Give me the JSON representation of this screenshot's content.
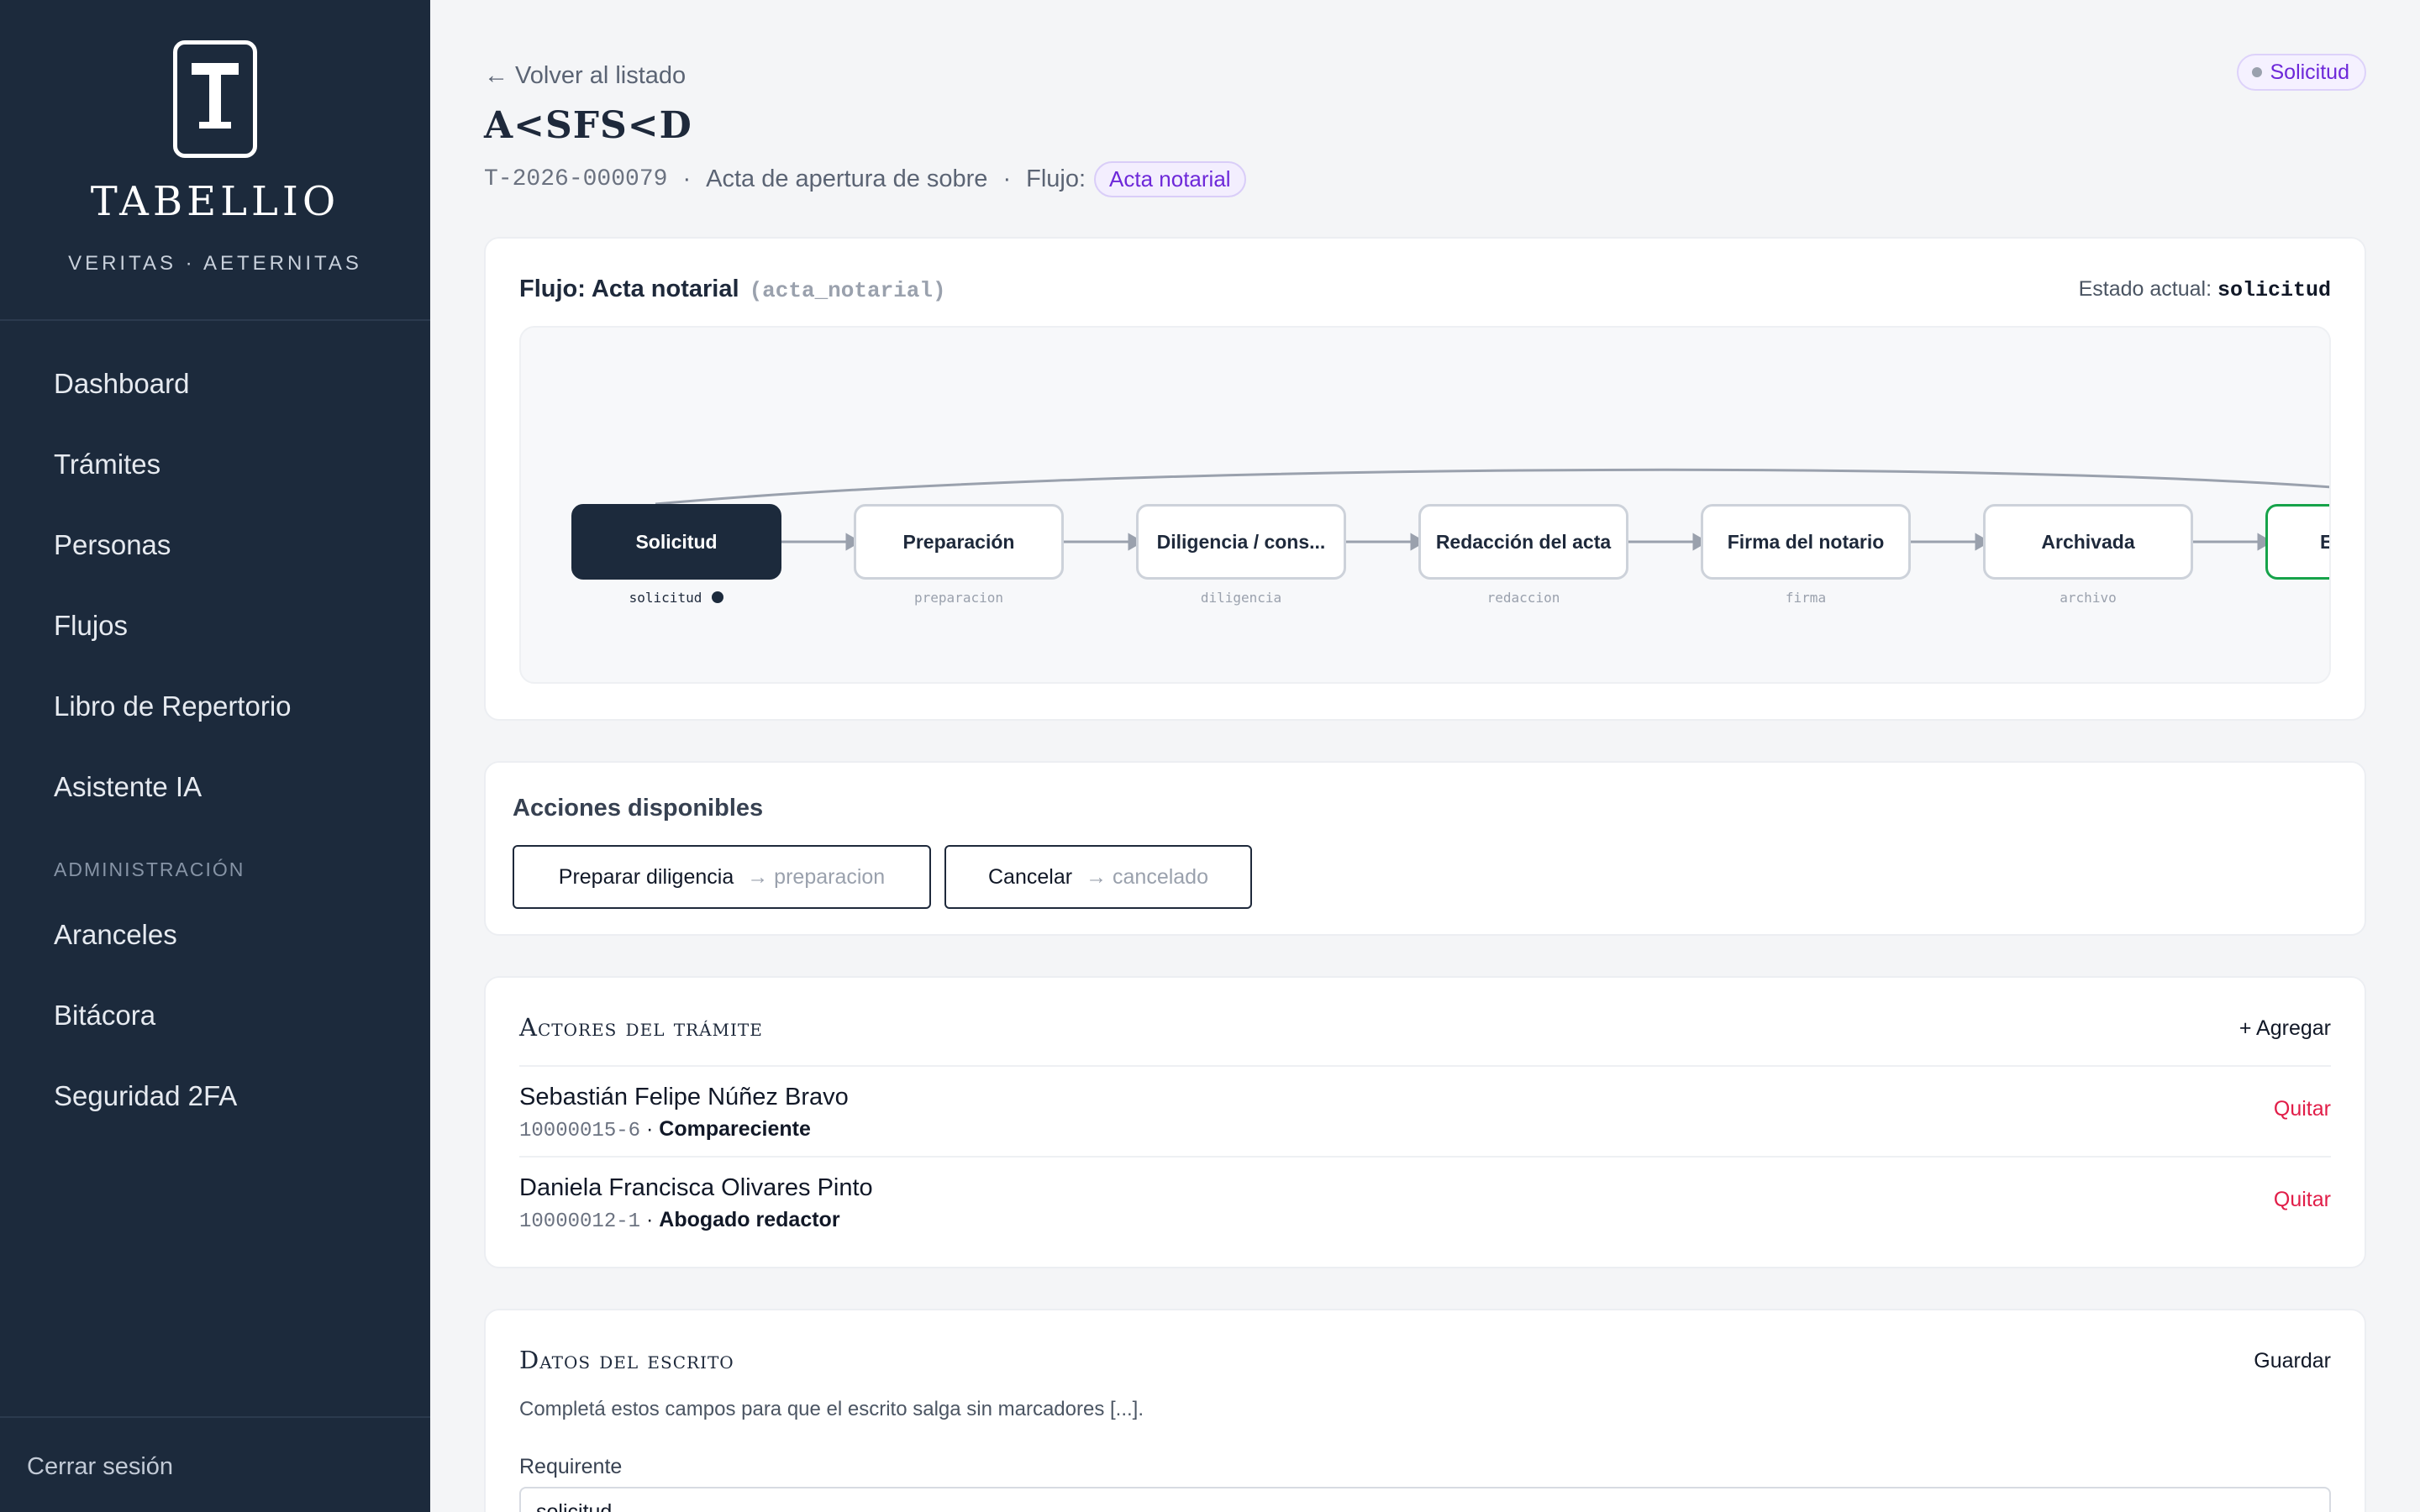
{
  "sidebar": {
    "brand_name": "TABELLIO",
    "motto": "VERITAS · AETERNITAS",
    "items": [
      {
        "label": "Dashboard"
      },
      {
        "label": "Trámites"
      },
      {
        "label": "Personas"
      },
      {
        "label": "Flujos"
      },
      {
        "label": "Libro de Repertorio"
      },
      {
        "label": "Asistente IA"
      }
    ],
    "section_admin": "ADMINISTRACIÓN",
    "admin_items": [
      {
        "label": "Aranceles"
      },
      {
        "label": "Bitácora"
      },
      {
        "label": "Seguridad 2FA"
      }
    ],
    "logout": "Cerrar sesión"
  },
  "header": {
    "back": "← Volver al listado",
    "title": "A<SFS<D",
    "code": "T-2026-000079",
    "doc_type": "Acta de apertura de sobre",
    "flow_label": "Flujo:",
    "flow_name": "Acta notarial",
    "status": "Solicitud",
    "separator": "·"
  },
  "flow": {
    "title": "Flujo: Acta notarial",
    "slug": "(acta_notarial)",
    "state_label": "Estado actual:",
    "state_value": "solicitud",
    "nodes": [
      {
        "label": "Solicitud",
        "key": "solicitud"
      },
      {
        "label": "Preparación",
        "key": "preparacion"
      },
      {
        "label": "Diligencia / cons...",
        "key": "diligencia"
      },
      {
        "label": "Redacción del acta",
        "key": "redaccion"
      },
      {
        "label": "Firma del notario",
        "key": "firma"
      },
      {
        "label": "Archivada",
        "key": "archivo"
      },
      {
        "label": "E",
        "key": ""
      }
    ]
  },
  "actions": {
    "title": "Acciones disponibles",
    "buttons": [
      {
        "label": "Preparar diligencia",
        "target": "→ preparacion"
      },
      {
        "label": "Cancelar",
        "target": "→ cancelado"
      }
    ]
  },
  "actors": {
    "title": "Actores del trámite",
    "add": "+ Agregar",
    "remove": "Quitar",
    "list": [
      {
        "name": "Sebastián Felipe Núñez Bravo",
        "rut": "10000015-6",
        "role": "Compareciente"
      },
      {
        "name": "Daniela Francisca Olivares Pinto",
        "rut": "10000012-1",
        "role": "Abogado redactor"
      }
    ]
  },
  "datos": {
    "title": "Datos del escrito",
    "save": "Guardar",
    "description": "Completá estos campos para que el escrito salga sin marcadores [...].",
    "field_label": "Requirente",
    "field_value": "solicitud"
  },
  "colors": {
    "sidebar_bg": "#1c2a3c",
    "accent_purple": "#6d28d9",
    "danger": "#e11d48",
    "final_green": "#16a34a"
  }
}
